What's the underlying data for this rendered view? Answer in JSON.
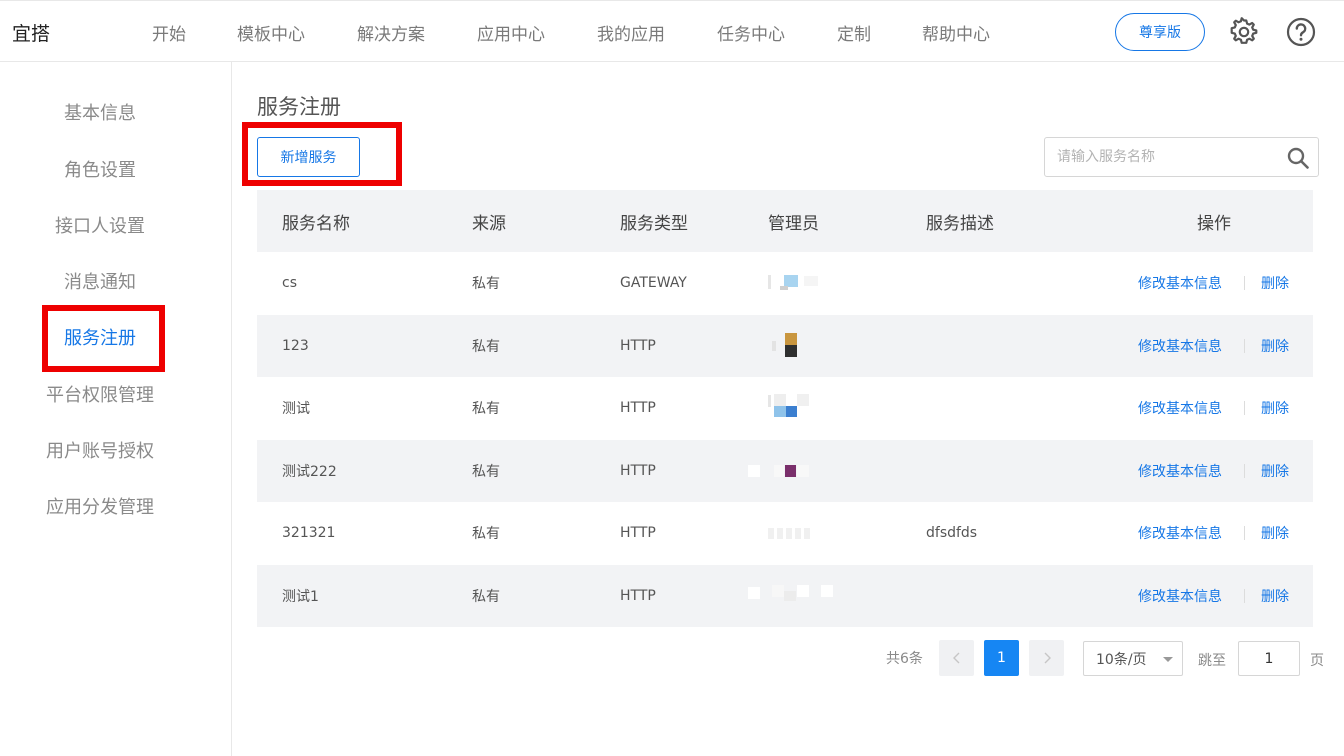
{
  "header": {
    "logo": "宜搭",
    "nav": [
      "开始",
      "模板中心",
      "解决方案",
      "应用中心",
      "我的应用",
      "任务中心",
      "定制",
      "帮助中心"
    ],
    "vip_label": "尊享版",
    "icons": [
      "gear-icon",
      "help-icon"
    ],
    "accent": "#1677e6"
  },
  "sidebar": {
    "items": [
      {
        "label": "基本信息",
        "active": false
      },
      {
        "label": "角色设置",
        "active": false
      },
      {
        "label": "接口人设置",
        "active": false
      },
      {
        "label": "消息通知",
        "active": false
      },
      {
        "label": "服务注册",
        "active": true
      },
      {
        "label": "平台权限管理",
        "active": false
      },
      {
        "label": "用户账号授权",
        "active": false
      },
      {
        "label": "应用分发管理",
        "active": false
      }
    ]
  },
  "main": {
    "title": "服务注册",
    "add_button": "新增服务",
    "search": {
      "placeholder": "请输入服务名称",
      "value": ""
    },
    "table": {
      "headers": [
        "服务名称",
        "来源",
        "服务类型",
        "管理员",
        "服务描述",
        "操作"
      ],
      "rows": [
        {
          "name": "cs",
          "source": "私有",
          "type": "GATEWAY",
          "admin": "",
          "desc": ""
        },
        {
          "name": "123",
          "source": "私有",
          "type": "HTTP",
          "admin": "",
          "desc": ""
        },
        {
          "name": "测试",
          "source": "私有",
          "type": "HTTP",
          "admin": "",
          "desc": ""
        },
        {
          "name": "测试222",
          "source": "私有",
          "type": "HTTP",
          "admin": "",
          "desc": ""
        },
        {
          "name": "321321",
          "source": "私有",
          "type": "HTTP",
          "admin": "",
          "desc": "dfsdfds"
        },
        {
          "name": "测试1",
          "source": "私有",
          "type": "HTTP",
          "admin": "",
          "desc": ""
        }
      ],
      "actions": {
        "edit": "修改基本信息",
        "delete": "删除"
      }
    },
    "pagination": {
      "total": "共6条",
      "current_page": "1",
      "page_size": "10条/页",
      "jump_label": "跳至",
      "jump_value": "1",
      "page_suffix": "页"
    }
  },
  "highlight_color": "#ee0000"
}
